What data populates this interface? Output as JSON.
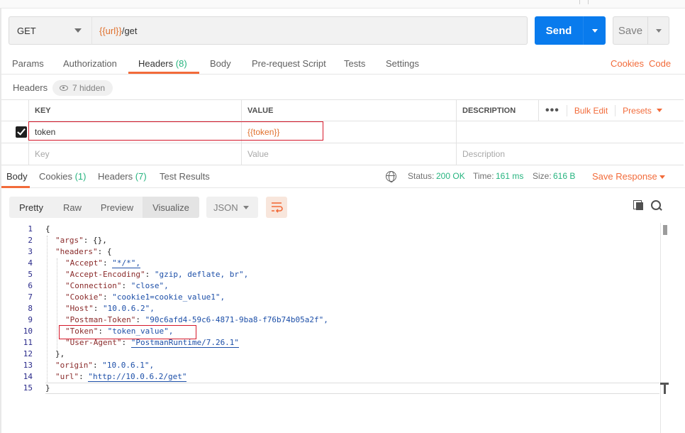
{
  "request": {
    "method": "GET",
    "url_var": "{{url}}",
    "url_path": "/get",
    "send_label": "Send",
    "save_label": "Save"
  },
  "request_tabs": {
    "params": "Params",
    "authorization": "Authorization",
    "headers": "Headers",
    "headers_count": "(8)",
    "body": "Body",
    "prerequest": "Pre-request Script",
    "tests": "Tests",
    "settings": "Settings",
    "cookies": "Cookies",
    "code": "Code"
  },
  "headers_section": {
    "title": "Headers",
    "hidden_label": "7 hidden",
    "col_key": "KEY",
    "col_value": "VALUE",
    "col_description": "DESCRIPTION",
    "more": "•••",
    "bulk_edit": "Bulk Edit",
    "presets": "Presets",
    "rows": [
      {
        "key": "token",
        "value": "{{token}}",
        "description": ""
      }
    ],
    "placeholder_key": "Key",
    "placeholder_value": "Value",
    "placeholder_description": "Description"
  },
  "response_tabs": {
    "body": "Body",
    "cookies": "Cookies",
    "cookies_count": "(1)",
    "headers": "Headers",
    "headers_count": "(7)",
    "test_results": "Test Results"
  },
  "response_meta": {
    "status_label": "Status:",
    "status_value": "200 OK",
    "time_label": "Time:",
    "time_value": "161 ms",
    "size_label": "Size:",
    "size_value": "616 B",
    "save_response": "Save Response"
  },
  "view_toolbar": {
    "pretty": "Pretty",
    "raw": "Raw",
    "preview": "Preview",
    "visualize": "Visualize",
    "format": "JSON"
  },
  "code_lines": [
    {
      "n": "1",
      "indent": 0,
      "key": "",
      "value": "",
      "text": "{"
    },
    {
      "n": "2",
      "indent": 1,
      "key": "\"args\"",
      "value": "{},",
      "text": ""
    },
    {
      "n": "3",
      "indent": 1,
      "key": "\"headers\"",
      "value": "{",
      "text": ""
    },
    {
      "n": "4",
      "indent": 2,
      "key": "\"Accept\"",
      "value": "\"*/*\",",
      "text": ""
    },
    {
      "n": "5",
      "indent": 2,
      "key": "\"Accept-Encoding\"",
      "value": "\"gzip, deflate, br\",",
      "text": ""
    },
    {
      "n": "6",
      "indent": 2,
      "key": "\"Connection\"",
      "value": "\"close\",",
      "text": ""
    },
    {
      "n": "7",
      "indent": 2,
      "key": "\"Cookie\"",
      "value": "\"cookie1=cookie_value1\",",
      "text": ""
    },
    {
      "n": "8",
      "indent": 2,
      "key": "\"Host\"",
      "value": "\"10.0.6.2\",",
      "text": ""
    },
    {
      "n": "9",
      "indent": 2,
      "key": "\"Postman-Token\"",
      "value": "\"90c6afd4-59c6-4871-9ba8-f76b74b05a2f\",",
      "text": ""
    },
    {
      "n": "10",
      "indent": 2,
      "key": "\"Token\"",
      "value": "\"token_value\",",
      "text": ""
    },
    {
      "n": "11",
      "indent": 2,
      "key": "\"User-Agent\"",
      "value": "\"PostmanRuntime/7.26.1\"",
      "text": ""
    },
    {
      "n": "12",
      "indent": 1,
      "key": "",
      "value": "",
      "text": "},"
    },
    {
      "n": "13",
      "indent": 1,
      "key": "\"origin\"",
      "value": "\"10.0.6.1\",",
      "text": ""
    },
    {
      "n": "14",
      "indent": 1,
      "key": "\"url\"",
      "value": "\"http://10.0.6.2/get\"",
      "text": ""
    },
    {
      "n": "15",
      "indent": 0,
      "key": "",
      "value": "",
      "text": "}"
    }
  ],
  "colors": {
    "accent_orange": "#f26b3a",
    "send_blue": "#097bed",
    "status_green": "#26b47f",
    "highlight_red": "#d6182a"
  }
}
